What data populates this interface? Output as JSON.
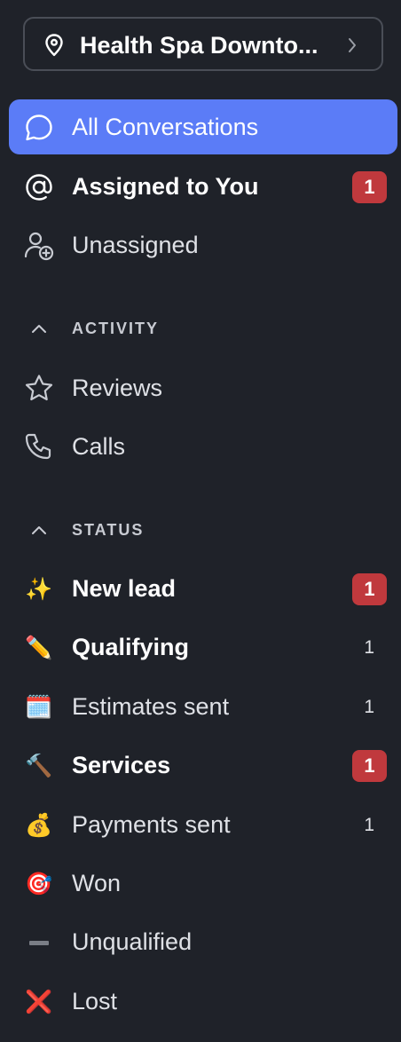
{
  "location": {
    "label": "Health Spa  Downto...",
    "icon": "map-pin-icon",
    "chevron_icon": "chevron-right-icon"
  },
  "nav": [
    {
      "label": "All Conversations",
      "icon": "chat-bubble-icon",
      "active": true
    },
    {
      "label": "Assigned to You",
      "icon": "at-sign-icon",
      "badge": "1"
    },
    {
      "label": "Unassigned",
      "icon": "user-plus-icon"
    }
  ],
  "activity": {
    "title": "ACTIVITY",
    "items": [
      {
        "label": "Reviews",
        "icon": "star-icon"
      },
      {
        "label": "Calls",
        "icon": "phone-icon"
      }
    ]
  },
  "status": {
    "title": "STATUS",
    "items": [
      {
        "label": "New lead",
        "emoji": "✨",
        "icon": "sparkles-icon",
        "badge": "1"
      },
      {
        "label": "Qualifying",
        "emoji": "✏️",
        "icon": "pencil-icon",
        "count": "1"
      },
      {
        "label": "Estimates sent",
        "emoji": "🗓️",
        "icon": "calendar-icon",
        "count": "1"
      },
      {
        "label": "Services",
        "emoji": "🔨",
        "icon": "hammer-icon",
        "badge": "1"
      },
      {
        "label": "Payments sent",
        "emoji": "💰",
        "icon": "money-bag-icon",
        "count": "1"
      },
      {
        "label": "Won",
        "emoji": "🎯",
        "icon": "target-icon"
      },
      {
        "label": "Unqualified",
        "icon": "dash-icon"
      },
      {
        "label": "Lost",
        "emoji": "❌",
        "icon": "cross-icon"
      }
    ]
  },
  "colors": {
    "background": "#1f2229",
    "active": "#5b7cf7",
    "badge": "#c0393d"
  }
}
